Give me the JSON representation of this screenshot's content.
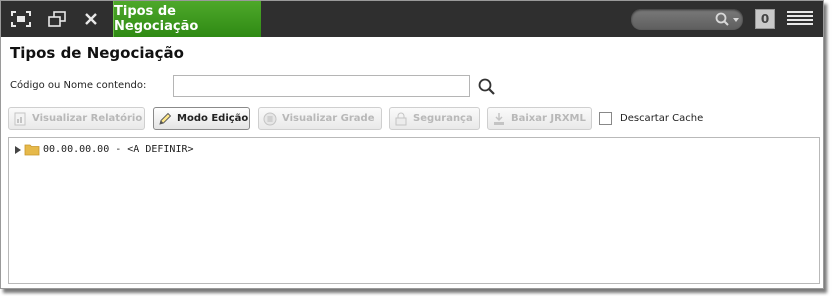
{
  "window": {
    "tab_title": "Tipos de Negociação",
    "notification_count": "0",
    "icons": [
      "maximize-icon",
      "restore-window-icon",
      "close-icon",
      "search-icon",
      "menu-icon"
    ]
  },
  "page": {
    "title": "Tipos de Negociação",
    "search_label": "Código ou Nome contendo:",
    "search_value": ""
  },
  "toolbar": {
    "view_report": "Visualizar Relatório",
    "edit_mode": "Modo Edição",
    "view_grid": "Visualizar Grade",
    "security": "Segurança",
    "download_jrxml": "Baixar JRXML",
    "discard_cache": "Descartar Cache"
  },
  "tree": {
    "root_label": "00.00.00.00 - <A DEFINIR>",
    "folder_color": "#e6b94a"
  },
  "colors": {
    "accent": "#3f9a1f",
    "topbar": "#2f2f2f"
  }
}
